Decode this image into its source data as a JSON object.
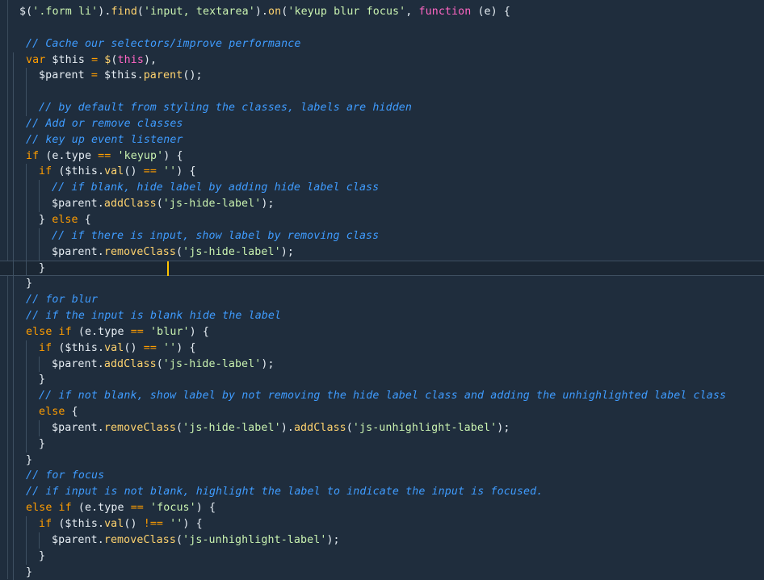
{
  "editor": {
    "theme": "dark-blue",
    "colors": {
      "background": "#1f2d3d",
      "function": "#ffd36e",
      "string": "#c9f2b0",
      "keyword": "#ff9d00",
      "keyword_alt": "#ff66c4",
      "comment": "#3f9cff",
      "plain": "#e6edf3",
      "caret": "#ffc400"
    },
    "current_line_index": 16,
    "lines": [
      [
        {
          "t": "$",
          "c": "plain"
        },
        {
          "t": "(",
          "c": "plain"
        },
        {
          "t": "'.form li'",
          "c": "str"
        },
        {
          "t": ").",
          "c": "plain"
        },
        {
          "t": "find",
          "c": "fn"
        },
        {
          "t": "(",
          "c": "plain"
        },
        {
          "t": "'input, textarea'",
          "c": "str"
        },
        {
          "t": ").",
          "c": "plain"
        },
        {
          "t": "on",
          "c": "fn"
        },
        {
          "t": "(",
          "c": "plain"
        },
        {
          "t": "'keyup blur focus'",
          "c": "str"
        },
        {
          "t": ", ",
          "c": "plain"
        },
        {
          "t": "function",
          "c": "kw2"
        },
        {
          "t": " (e) {",
          "c": "plain"
        }
      ],
      [],
      [
        {
          "t": "// Cache our selectors/improve performance",
          "c": "com"
        }
      ],
      [
        {
          "t": "var",
          "c": "kw"
        },
        {
          "t": " $this ",
          "c": "plain"
        },
        {
          "t": "=",
          "c": "kw"
        },
        {
          "t": " ",
          "c": "plain"
        },
        {
          "t": "$",
          "c": "fn"
        },
        {
          "t": "(",
          "c": "plain"
        },
        {
          "t": "this",
          "c": "kw2"
        },
        {
          "t": "),",
          "c": "plain"
        }
      ],
      [
        {
          "t": "$parent ",
          "c": "plain"
        },
        {
          "t": "=",
          "c": "kw"
        },
        {
          "t": " $this.",
          "c": "plain"
        },
        {
          "t": "parent",
          "c": "fn"
        },
        {
          "t": "();",
          "c": "plain"
        }
      ],
      [],
      [
        {
          "t": "// by default from styling the classes, labels are hidden",
          "c": "com"
        }
      ],
      [
        {
          "t": "// Add or remove classes",
          "c": "com"
        }
      ],
      [
        {
          "t": "// key up event listener",
          "c": "com"
        }
      ],
      [
        {
          "t": "if",
          "c": "kw"
        },
        {
          "t": " (e.type ",
          "c": "plain"
        },
        {
          "t": "==",
          "c": "kw"
        },
        {
          "t": " ",
          "c": "plain"
        },
        {
          "t": "'keyup'",
          "c": "str"
        },
        {
          "t": ") {",
          "c": "plain"
        }
      ],
      [
        {
          "t": "if",
          "c": "kw"
        },
        {
          "t": " ($this.",
          "c": "plain"
        },
        {
          "t": "val",
          "c": "fn"
        },
        {
          "t": "() ",
          "c": "plain"
        },
        {
          "t": "==",
          "c": "kw"
        },
        {
          "t": " ",
          "c": "plain"
        },
        {
          "t": "''",
          "c": "str"
        },
        {
          "t": ") {",
          "c": "plain"
        }
      ],
      [
        {
          "t": "// if blank, hide label by adding hide label class",
          "c": "com"
        }
      ],
      [
        {
          "t": "$parent.",
          "c": "plain"
        },
        {
          "t": "addClass",
          "c": "fn"
        },
        {
          "t": "(",
          "c": "plain"
        },
        {
          "t": "'js-hide-label'",
          "c": "str"
        },
        {
          "t": ");",
          "c": "plain"
        }
      ],
      [
        {
          "t": "} ",
          "c": "plain"
        },
        {
          "t": "else",
          "c": "kw"
        },
        {
          "t": " {",
          "c": "plain"
        }
      ],
      [
        {
          "t": "// if there is input, show label by removing class",
          "c": "com"
        }
      ],
      [
        {
          "t": "$parent.",
          "c": "plain"
        },
        {
          "t": "removeClass",
          "c": "fn"
        },
        {
          "t": "(",
          "c": "plain"
        },
        {
          "t": "'js-hide-label'",
          "c": "str"
        },
        {
          "t": ");",
          "c": "plain"
        }
      ],
      [
        {
          "t": "}",
          "c": "plain"
        }
      ],
      [
        {
          "t": "}",
          "c": "plain"
        }
      ],
      [
        {
          "t": "// for blur",
          "c": "com"
        }
      ],
      [
        {
          "t": "// if the input is blank hide the label",
          "c": "com"
        }
      ],
      [
        {
          "t": "else",
          "c": "kw"
        },
        {
          "t": " ",
          "c": "plain"
        },
        {
          "t": "if",
          "c": "kw"
        },
        {
          "t": " (e.type ",
          "c": "plain"
        },
        {
          "t": "==",
          "c": "kw"
        },
        {
          "t": " ",
          "c": "plain"
        },
        {
          "t": "'blur'",
          "c": "str"
        },
        {
          "t": ") {",
          "c": "plain"
        }
      ],
      [
        {
          "t": "if",
          "c": "kw"
        },
        {
          "t": " ($this.",
          "c": "plain"
        },
        {
          "t": "val",
          "c": "fn"
        },
        {
          "t": "() ",
          "c": "plain"
        },
        {
          "t": "==",
          "c": "kw"
        },
        {
          "t": " ",
          "c": "plain"
        },
        {
          "t": "''",
          "c": "str"
        },
        {
          "t": ") {",
          "c": "plain"
        }
      ],
      [
        {
          "t": "$parent.",
          "c": "plain"
        },
        {
          "t": "addClass",
          "c": "fn"
        },
        {
          "t": "(",
          "c": "plain"
        },
        {
          "t": "'js-hide-label'",
          "c": "str"
        },
        {
          "t": ");",
          "c": "plain"
        }
      ],
      [
        {
          "t": "}",
          "c": "plain"
        }
      ],
      [
        {
          "t": "// if not blank, show label by not removing the hide label class and adding the unhighlighted label class",
          "c": "com"
        }
      ],
      [
        {
          "t": "else",
          "c": "kw"
        },
        {
          "t": " {",
          "c": "plain"
        }
      ],
      [
        {
          "t": "$parent.",
          "c": "plain"
        },
        {
          "t": "removeClass",
          "c": "fn"
        },
        {
          "t": "(",
          "c": "plain"
        },
        {
          "t": "'js-hide-label'",
          "c": "str"
        },
        {
          "t": ").",
          "c": "plain"
        },
        {
          "t": "addClass",
          "c": "fn"
        },
        {
          "t": "(",
          "c": "plain"
        },
        {
          "t": "'js-unhighlight-label'",
          "c": "str"
        },
        {
          "t": ");",
          "c": "plain"
        }
      ],
      [
        {
          "t": "}",
          "c": "plain"
        }
      ],
      [
        {
          "t": "}",
          "c": "plain"
        }
      ],
      [
        {
          "t": "// for focus",
          "c": "com"
        }
      ],
      [
        {
          "t": "// if input is not blank, highlight the label to indicate the input is focused.",
          "c": "com"
        }
      ],
      [
        {
          "t": "else",
          "c": "kw"
        },
        {
          "t": " ",
          "c": "plain"
        },
        {
          "t": "if",
          "c": "kw"
        },
        {
          "t": " (e.type ",
          "c": "plain"
        },
        {
          "t": "==",
          "c": "kw"
        },
        {
          "t": " ",
          "c": "plain"
        },
        {
          "t": "'focus'",
          "c": "str"
        },
        {
          "t": ") {",
          "c": "plain"
        }
      ],
      [
        {
          "t": "if",
          "c": "kw"
        },
        {
          "t": " ($this.",
          "c": "plain"
        },
        {
          "t": "val",
          "c": "fn"
        },
        {
          "t": "() ",
          "c": "plain"
        },
        {
          "t": "!==",
          "c": "kw"
        },
        {
          "t": " ",
          "c": "plain"
        },
        {
          "t": "''",
          "c": "str"
        },
        {
          "t": ") {",
          "c": "plain"
        }
      ],
      [
        {
          "t": "$parent.",
          "c": "plain"
        },
        {
          "t": "removeClass",
          "c": "fn"
        },
        {
          "t": "(",
          "c": "plain"
        },
        {
          "t": "'js-unhighlight-label'",
          "c": "str"
        },
        {
          "t": ");",
          "c": "plain"
        }
      ],
      [
        {
          "t": "}",
          "c": "plain"
        }
      ],
      [
        {
          "t": "}",
          "c": "plain"
        }
      ]
    ]
  }
}
